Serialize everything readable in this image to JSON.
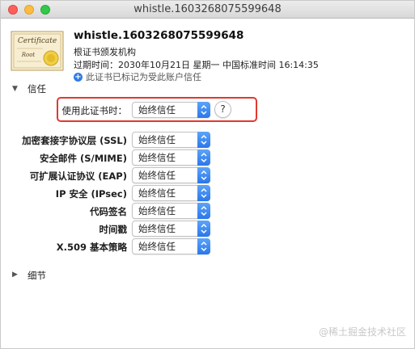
{
  "window": {
    "title": "whistle.1603268075599648"
  },
  "certificate": {
    "icon_text_top": "Certificate",
    "icon_text_bottom": "Root",
    "name": "whistle.1603268075599648",
    "subtitle": "根证书颁发机构",
    "expiry": "过期时间：2030年10月21日 星期一 中国标准时间 16:14:35",
    "trust_status": "此证书已标记为受此账户信任"
  },
  "trust_section": {
    "label": "信任",
    "main_setting": {
      "label": "使用此证书时：",
      "value": "始终信任"
    },
    "help_label": "?",
    "rows": [
      {
        "label": "加密套接字协议层 (SSL)",
        "value": "始终信任"
      },
      {
        "label": "安全邮件 (S/MIME)",
        "value": "始终信任"
      },
      {
        "label": "可扩展认证协议 (EAP)",
        "value": "始终信任"
      },
      {
        "label": "IP 安全 (IPsec)",
        "value": "始终信任"
      },
      {
        "label": "代码签名",
        "value": "始终信任"
      },
      {
        "label": "时间戳",
        "value": "始终信任"
      },
      {
        "label": "X.509 基本策略",
        "value": "始终信任"
      }
    ]
  },
  "details_section": {
    "label": "细节"
  },
  "watermark": "@稀土掘金技术社区",
  "colors": {
    "highlight": "#e0392e",
    "popup_accent": "#2a77ea",
    "trust_icon": "#2f7ce6"
  }
}
